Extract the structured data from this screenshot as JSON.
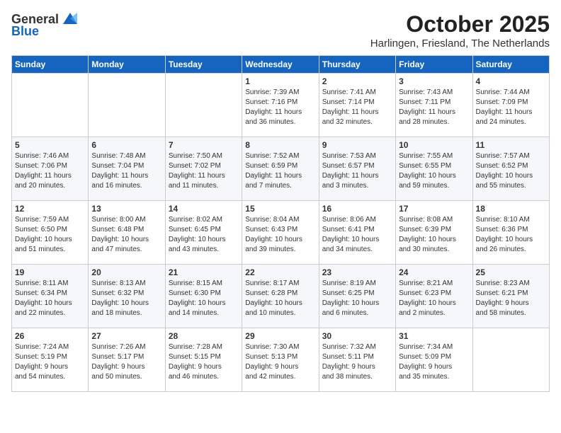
{
  "header": {
    "logo_general": "General",
    "logo_blue": "Blue",
    "month": "October 2025",
    "location": "Harlingen, Friesland, The Netherlands"
  },
  "days_of_week": [
    "Sunday",
    "Monday",
    "Tuesday",
    "Wednesday",
    "Thursday",
    "Friday",
    "Saturday"
  ],
  "weeks": [
    [
      {
        "day": "",
        "info": ""
      },
      {
        "day": "",
        "info": ""
      },
      {
        "day": "",
        "info": ""
      },
      {
        "day": "1",
        "info": "Sunrise: 7:39 AM\nSunset: 7:16 PM\nDaylight: 11 hours\nand 36 minutes."
      },
      {
        "day": "2",
        "info": "Sunrise: 7:41 AM\nSunset: 7:14 PM\nDaylight: 11 hours\nand 32 minutes."
      },
      {
        "day": "3",
        "info": "Sunrise: 7:43 AM\nSunset: 7:11 PM\nDaylight: 11 hours\nand 28 minutes."
      },
      {
        "day": "4",
        "info": "Sunrise: 7:44 AM\nSunset: 7:09 PM\nDaylight: 11 hours\nand 24 minutes."
      }
    ],
    [
      {
        "day": "5",
        "info": "Sunrise: 7:46 AM\nSunset: 7:06 PM\nDaylight: 11 hours\nand 20 minutes."
      },
      {
        "day": "6",
        "info": "Sunrise: 7:48 AM\nSunset: 7:04 PM\nDaylight: 11 hours\nand 16 minutes."
      },
      {
        "day": "7",
        "info": "Sunrise: 7:50 AM\nSunset: 7:02 PM\nDaylight: 11 hours\nand 11 minutes."
      },
      {
        "day": "8",
        "info": "Sunrise: 7:52 AM\nSunset: 6:59 PM\nDaylight: 11 hours\nand 7 minutes."
      },
      {
        "day": "9",
        "info": "Sunrise: 7:53 AM\nSunset: 6:57 PM\nDaylight: 11 hours\nand 3 minutes."
      },
      {
        "day": "10",
        "info": "Sunrise: 7:55 AM\nSunset: 6:55 PM\nDaylight: 10 hours\nand 59 minutes."
      },
      {
        "day": "11",
        "info": "Sunrise: 7:57 AM\nSunset: 6:52 PM\nDaylight: 10 hours\nand 55 minutes."
      }
    ],
    [
      {
        "day": "12",
        "info": "Sunrise: 7:59 AM\nSunset: 6:50 PM\nDaylight: 10 hours\nand 51 minutes."
      },
      {
        "day": "13",
        "info": "Sunrise: 8:00 AM\nSunset: 6:48 PM\nDaylight: 10 hours\nand 47 minutes."
      },
      {
        "day": "14",
        "info": "Sunrise: 8:02 AM\nSunset: 6:45 PM\nDaylight: 10 hours\nand 43 minutes."
      },
      {
        "day": "15",
        "info": "Sunrise: 8:04 AM\nSunset: 6:43 PM\nDaylight: 10 hours\nand 39 minutes."
      },
      {
        "day": "16",
        "info": "Sunrise: 8:06 AM\nSunset: 6:41 PM\nDaylight: 10 hours\nand 34 minutes."
      },
      {
        "day": "17",
        "info": "Sunrise: 8:08 AM\nSunset: 6:39 PM\nDaylight: 10 hours\nand 30 minutes."
      },
      {
        "day": "18",
        "info": "Sunrise: 8:10 AM\nSunset: 6:36 PM\nDaylight: 10 hours\nand 26 minutes."
      }
    ],
    [
      {
        "day": "19",
        "info": "Sunrise: 8:11 AM\nSunset: 6:34 PM\nDaylight: 10 hours\nand 22 minutes."
      },
      {
        "day": "20",
        "info": "Sunrise: 8:13 AM\nSunset: 6:32 PM\nDaylight: 10 hours\nand 18 minutes."
      },
      {
        "day": "21",
        "info": "Sunrise: 8:15 AM\nSunset: 6:30 PM\nDaylight: 10 hours\nand 14 minutes."
      },
      {
        "day": "22",
        "info": "Sunrise: 8:17 AM\nSunset: 6:28 PM\nDaylight: 10 hours\nand 10 minutes."
      },
      {
        "day": "23",
        "info": "Sunrise: 8:19 AM\nSunset: 6:25 PM\nDaylight: 10 hours\nand 6 minutes."
      },
      {
        "day": "24",
        "info": "Sunrise: 8:21 AM\nSunset: 6:23 PM\nDaylight: 10 hours\nand 2 minutes."
      },
      {
        "day": "25",
        "info": "Sunrise: 8:23 AM\nSunset: 6:21 PM\nDaylight: 9 hours\nand 58 minutes."
      }
    ],
    [
      {
        "day": "26",
        "info": "Sunrise: 7:24 AM\nSunset: 5:19 PM\nDaylight: 9 hours\nand 54 minutes."
      },
      {
        "day": "27",
        "info": "Sunrise: 7:26 AM\nSunset: 5:17 PM\nDaylight: 9 hours\nand 50 minutes."
      },
      {
        "day": "28",
        "info": "Sunrise: 7:28 AM\nSunset: 5:15 PM\nDaylight: 9 hours\nand 46 minutes."
      },
      {
        "day": "29",
        "info": "Sunrise: 7:30 AM\nSunset: 5:13 PM\nDaylight: 9 hours\nand 42 minutes."
      },
      {
        "day": "30",
        "info": "Sunrise: 7:32 AM\nSunset: 5:11 PM\nDaylight: 9 hours\nand 38 minutes."
      },
      {
        "day": "31",
        "info": "Sunrise: 7:34 AM\nSunset: 5:09 PM\nDaylight: 9 hours\nand 35 minutes."
      },
      {
        "day": "",
        "info": ""
      }
    ]
  ]
}
